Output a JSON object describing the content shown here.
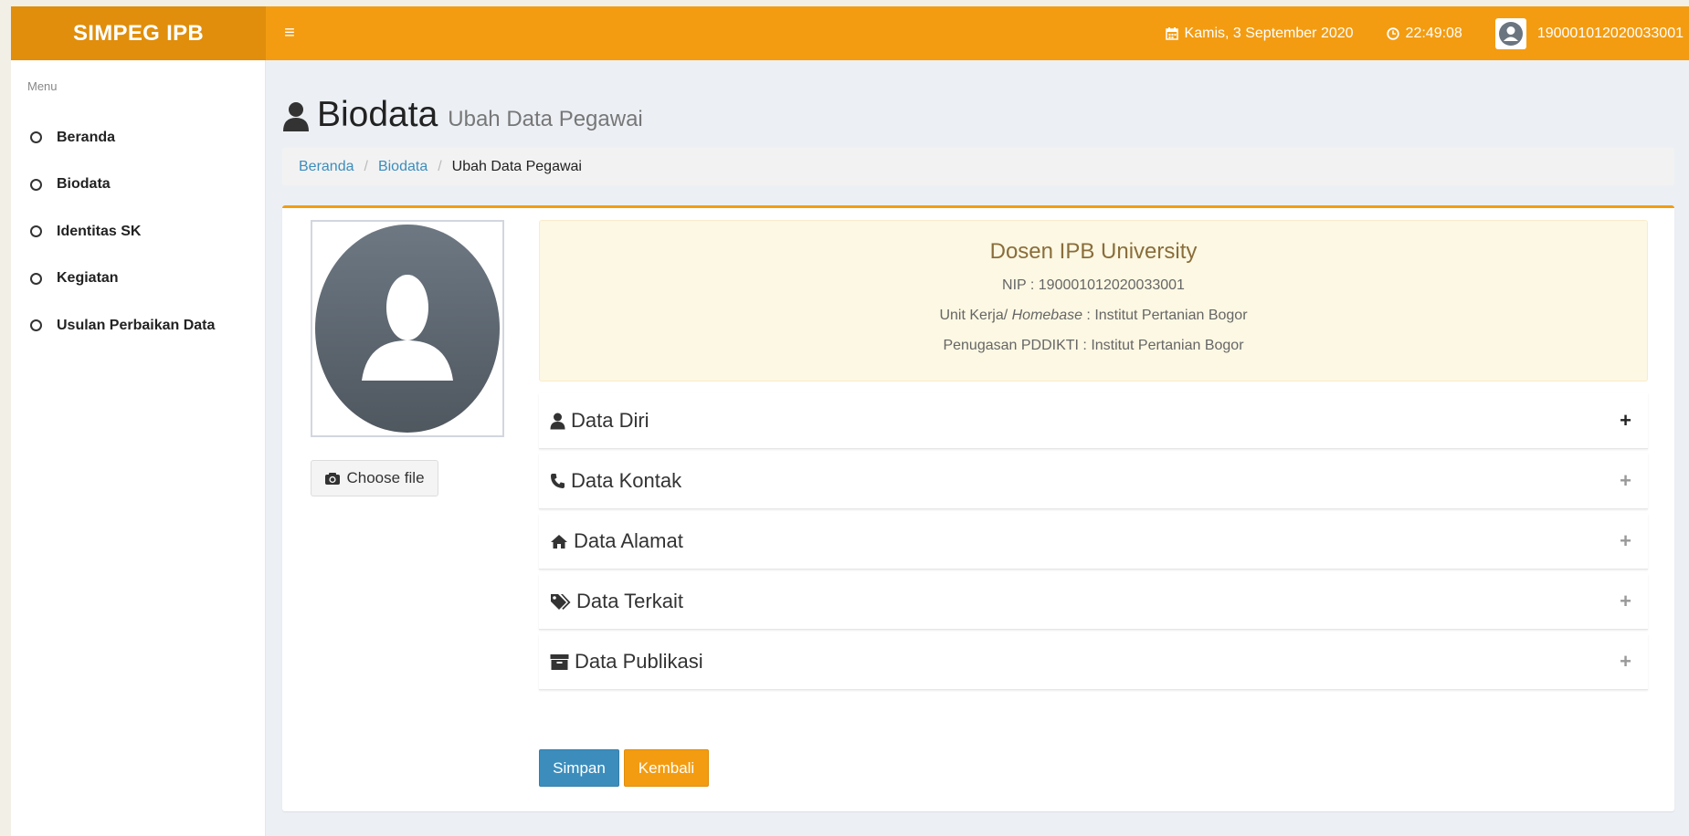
{
  "app": {
    "title": "SIMPEG IPB"
  },
  "header": {
    "date": "Kamis, 3 September 2020",
    "time": "22:49:08",
    "user_id": "190001012020033001"
  },
  "sidebar": {
    "label": "Menu",
    "items": [
      {
        "label": "Beranda"
      },
      {
        "label": "Biodata"
      },
      {
        "label": "Identitas SK"
      },
      {
        "label": "Kegiatan"
      },
      {
        "label": "Usulan Perbaikan Data"
      }
    ]
  },
  "page": {
    "title": "Biodata",
    "subtitle": "Ubah Data Pegawai",
    "breadcrumb": [
      "Beranda",
      "Biodata",
      "Ubah Data Pegawai"
    ]
  },
  "profile": {
    "choose_file_label": "Choose file",
    "heading": "Dosen IPB University",
    "nip": "NIP : 190001012020033001",
    "unit_kerja_prefix": "Unit Kerja/ ",
    "unit_kerja_em": "Homebase",
    "unit_kerja_value": " : Institut Pertanian Bogor",
    "penugasan": "Penugasan PDDIKTI : Institut Pertanian Bogor"
  },
  "sections": [
    {
      "label": "Data Diri",
      "icon": "user-icon"
    },
    {
      "label": "Data Kontak",
      "icon": "phone-icon"
    },
    {
      "label": "Data Alamat",
      "icon": "home-icon"
    },
    {
      "label": "Data Terkait",
      "icon": "tags-icon"
    },
    {
      "label": "Data Publikasi",
      "icon": "archive-icon"
    }
  ],
  "actions": {
    "save": "Simpan",
    "back": "Kembali"
  },
  "colors": {
    "accent": "#f39c12",
    "accent_dark": "#e08e0b",
    "primary": "#3c8dbc",
    "info_bg": "#fcf8e3"
  }
}
